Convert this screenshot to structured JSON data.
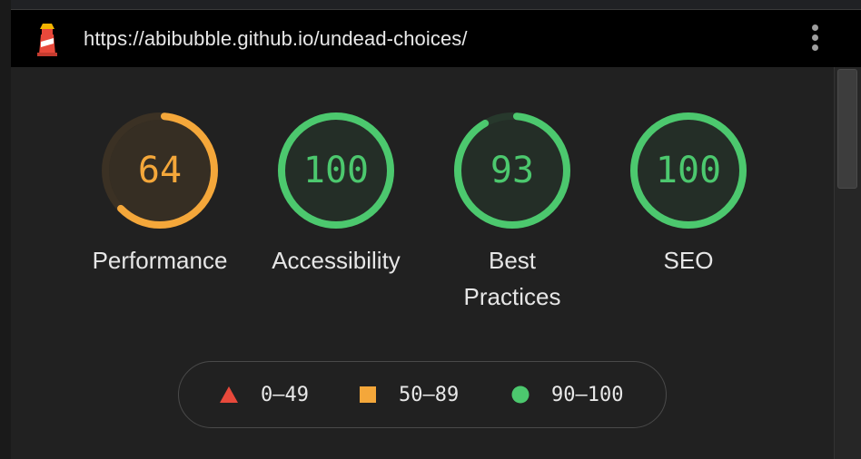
{
  "topbar": {
    "url": "https://abibubble.github.io/undead-choices/",
    "logo_icon": "lighthouse-icon",
    "menu_icon": "kebab-menu-icon"
  },
  "colors": {
    "fail": "#e8493b",
    "average": "#f4a73a",
    "pass": "#4cc86e"
  },
  "gauges": [
    {
      "score": "64",
      "label_lines": [
        "Performance"
      ],
      "status": "average",
      "fraction": 0.64
    },
    {
      "score": "100",
      "label_lines": [
        "Accessibility"
      ],
      "status": "pass",
      "fraction": 1.0
    },
    {
      "score": "93",
      "label_lines": [
        "Best",
        "Practices"
      ],
      "status": "pass",
      "fraction": 0.93
    },
    {
      "score": "100",
      "label_lines": [
        "SEO"
      ],
      "status": "pass",
      "fraction": 1.0
    }
  ],
  "legend": [
    {
      "icon": "triangle-icon",
      "range": "0–49",
      "status": "fail"
    },
    {
      "icon": "square-icon",
      "range": "50–89",
      "status": "average"
    },
    {
      "icon": "circle-icon",
      "range": "90–100",
      "status": "pass"
    }
  ]
}
